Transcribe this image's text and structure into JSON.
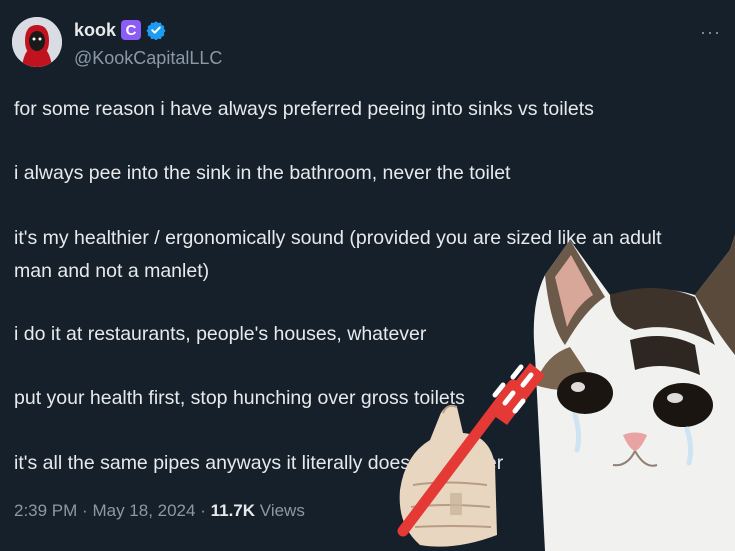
{
  "tweet": {
    "display_name": "kook",
    "badge_letter": "C",
    "handle": "@KookCapitalLLC",
    "more": "···",
    "paragraphs": [
      "for some reason i have always preferred peeing into sinks vs toilets",
      "i always pee into the sink in the bathroom, never the toilet",
      "it's my healthier / ergonomically sound (provided you are sized like an adult man and not a manlet)",
      "i do it at restaurants, people's houses, whatever",
      "put your health first, stop hunching over gross toilets",
      "it's all the same pipes anyways it literally does not matter"
    ],
    "time": "2:39 PM",
    "date": "May 18, 2024",
    "views_count": "11.7K",
    "views_label": "Views",
    "separator": "·"
  },
  "colors": {
    "background": "#15202b",
    "text": "#e7e9ea",
    "secondary": "#8b98a5",
    "verified": "#1d9bf0",
    "badge": "#8b5cf6"
  },
  "icons": [
    "avatar-image",
    "purple-badge-icon",
    "verified-icon",
    "more-icon",
    "crying-cat-meme",
    "toothbrush-icon"
  ]
}
